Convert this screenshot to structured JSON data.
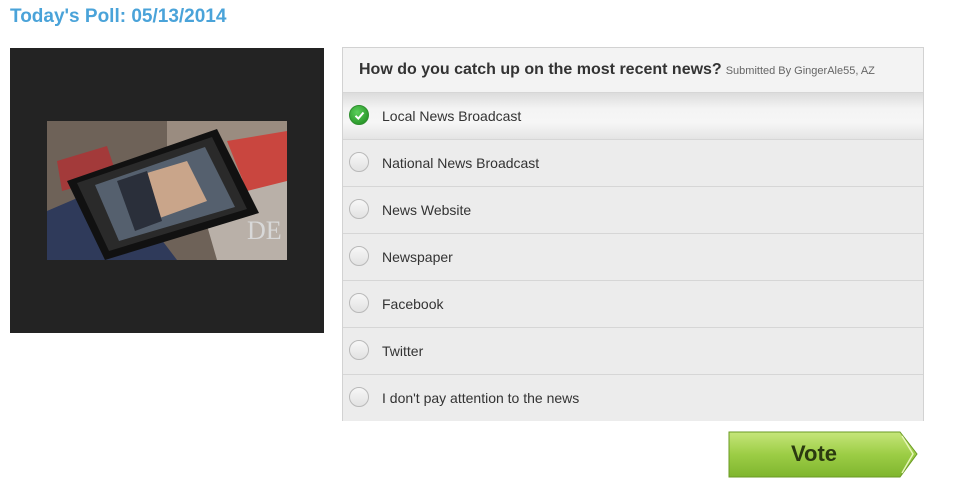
{
  "poll": {
    "title": "Today's Poll: 05/13/2014",
    "question": "How do you catch up on the most recent news?",
    "submitted_by": "Submitted By GingerAle55, AZ",
    "options": [
      {
        "label": "Local News Broadcast",
        "selected": true
      },
      {
        "label": "National News Broadcast",
        "selected": false
      },
      {
        "label": "News Website",
        "selected": false
      },
      {
        "label": "Newspaper",
        "selected": false
      },
      {
        "label": "Facebook",
        "selected": false
      },
      {
        "label": "Twitter",
        "selected": false
      },
      {
        "label": "I don't pay attention to the news",
        "selected": false
      }
    ],
    "vote_label": "Vote"
  },
  "colors": {
    "title": "#4aa3d9",
    "selected_radio": "#2e9d2e",
    "vote_button": "#8cc63f"
  }
}
